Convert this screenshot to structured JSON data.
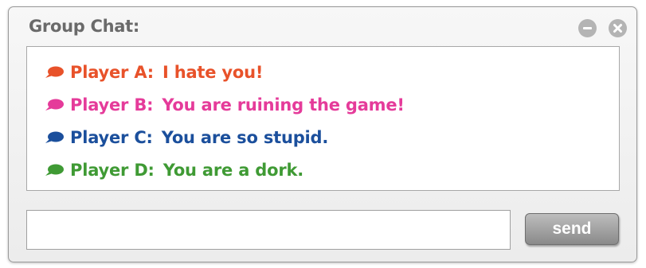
{
  "window": {
    "title": "Group Chat:"
  },
  "icons": {
    "minimize": "minimize-icon",
    "close": "close-icon",
    "message": "speech-bubble-icon"
  },
  "messages": [
    {
      "name": "Player A:",
      "text": "I hate you!",
      "color": "#e8522a"
    },
    {
      "name": "Player B:",
      "text": "You are ruining the game!",
      "color": "#e53b9a"
    },
    {
      "name": "Player C:",
      "text": "You are so stupid.",
      "color": "#1b4f9c"
    },
    {
      "name": "Player D:",
      "text": "You are a dork.",
      "color": "#3f9a34"
    }
  ],
  "input": {
    "value": "",
    "placeholder": ""
  },
  "send_label": "send"
}
